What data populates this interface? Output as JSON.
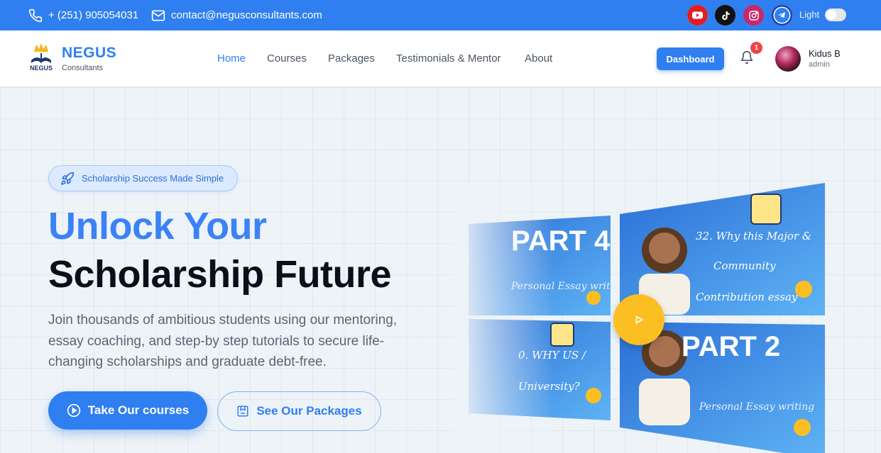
{
  "topbar": {
    "phone": "+ (251) 905054031",
    "email": "contact@negusconsultants.com",
    "social": [
      "youtube-icon",
      "tiktok-icon",
      "instagram-icon",
      "telegram-icon"
    ],
    "theme_label": "Light"
  },
  "nav": {
    "brand": "NEGUS",
    "brand_sub": "Consultants",
    "logo_text": "NEGUS",
    "links": [
      "Home",
      "Courses",
      "Packages",
      "Testimonials & Mentor",
      "About"
    ],
    "active": "Home",
    "dashboard_label": "Dashboard",
    "notification_count": "1",
    "user_name": "Kidus B",
    "user_role": "admin"
  },
  "hero": {
    "pill_label": "Scholarship Success Made Simple",
    "title_line1": "Unlock Your",
    "title_line2": "Scholarship Future",
    "description": "Join thousands of ambitious students using our mentoring, essay coaching, and step-by step tutorials to secure life-changing scholarships and graduate debt-free.",
    "primary_button": "Take Our courses",
    "secondary_button": "See Our Packages"
  },
  "video": {
    "tiles": [
      {
        "title": "PART 4",
        "caption": "Personal Essay writing"
      },
      {
        "title": "",
        "caption": "32. Why this Major & Community Contribution essay"
      },
      {
        "title": "",
        "caption": "0. WHY US / University?"
      },
      {
        "title": "PART 2",
        "caption": "Personal Essay writing"
      }
    ]
  },
  "colors": {
    "primary": "#2f7ff0",
    "accent_yellow": "#fbbf24",
    "notification": "#ef4444"
  }
}
